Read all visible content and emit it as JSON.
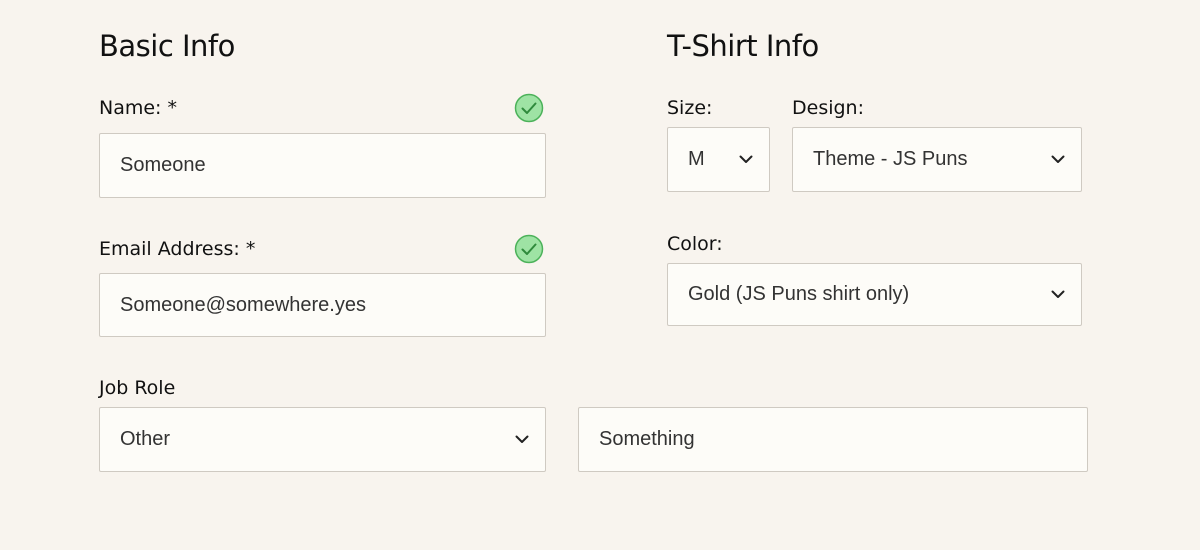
{
  "basic_info": {
    "heading": "Basic Info",
    "name": {
      "label": "Name:",
      "required_mark": "*",
      "value": "Someone",
      "valid": true
    },
    "email": {
      "label": "Email Address:",
      "required_mark": "*",
      "value": "Someone@somewhere.yes",
      "valid": true
    },
    "job_role": {
      "label": "Job Role",
      "selected": "Other",
      "other_value": "Something"
    }
  },
  "tshirt_info": {
    "heading": "T-Shirt Info",
    "size": {
      "label": "Size:",
      "selected": "M"
    },
    "design": {
      "label": "Design:",
      "selected": "Theme - JS Puns"
    },
    "color": {
      "label": "Color:",
      "selected": "Gold (JS Puns shirt only)"
    }
  },
  "icons": {
    "valid": "check-circle-icon",
    "dropdown": "chevron-down-icon"
  },
  "colors": {
    "background": "#f8f4ee",
    "field_background": "#fdfcf8",
    "field_border": "#cfcac2",
    "valid_fill": "#9ee3a4",
    "valid_stroke": "#4cb25a"
  }
}
